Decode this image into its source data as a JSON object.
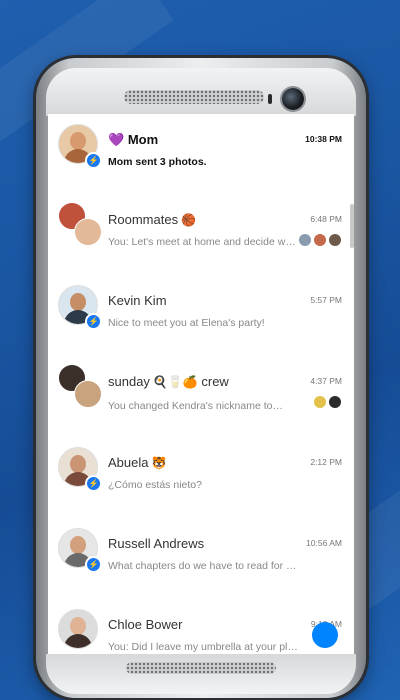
{
  "conversations": [
    {
      "name": "Mom",
      "name_prefix_emoji": "💜",
      "preview": "Mom sent 3 photos.",
      "time": "10:38 PM",
      "unread": true
    },
    {
      "name": "Roommates",
      "name_suffix_emoji": "🏀",
      "preview": "You: Let's meet at home and decide wh...",
      "time": "6:48 PM",
      "unread": false
    },
    {
      "name": "Kevin Kim",
      "preview": "Nice to meet you at Elena's party!",
      "time": "5:57 PM",
      "unread": false
    },
    {
      "name": "sunday",
      "name_middle_emoji": "🍳🥛🍊",
      "name_suffix": "crew",
      "preview": "You changed Kendra's nickname to",
      "preview_emoji": "💃🔥",
      "time": "4:37 PM",
      "unread": false
    },
    {
      "name": "Abuela",
      "name_suffix_emoji": "🐯",
      "preview": "¿Cómo estás nieto?",
      "time": "2:12 PM",
      "unread": false
    },
    {
      "name": "Russell Andrews",
      "preview": "What chapters do we have to read for tomorro...",
      "time": "10:56 AM",
      "unread": false
    },
    {
      "name": "Chloe Bower",
      "preview": "You: Did I leave my umbrella at your place?",
      "time": "9:10 AM",
      "unread": false
    }
  ],
  "colors": {
    "messenger_blue": "#1877f2",
    "background_blue": "#1a56a2"
  },
  "icons": {
    "messenger_badge": "messenger-bolt-icon"
  }
}
